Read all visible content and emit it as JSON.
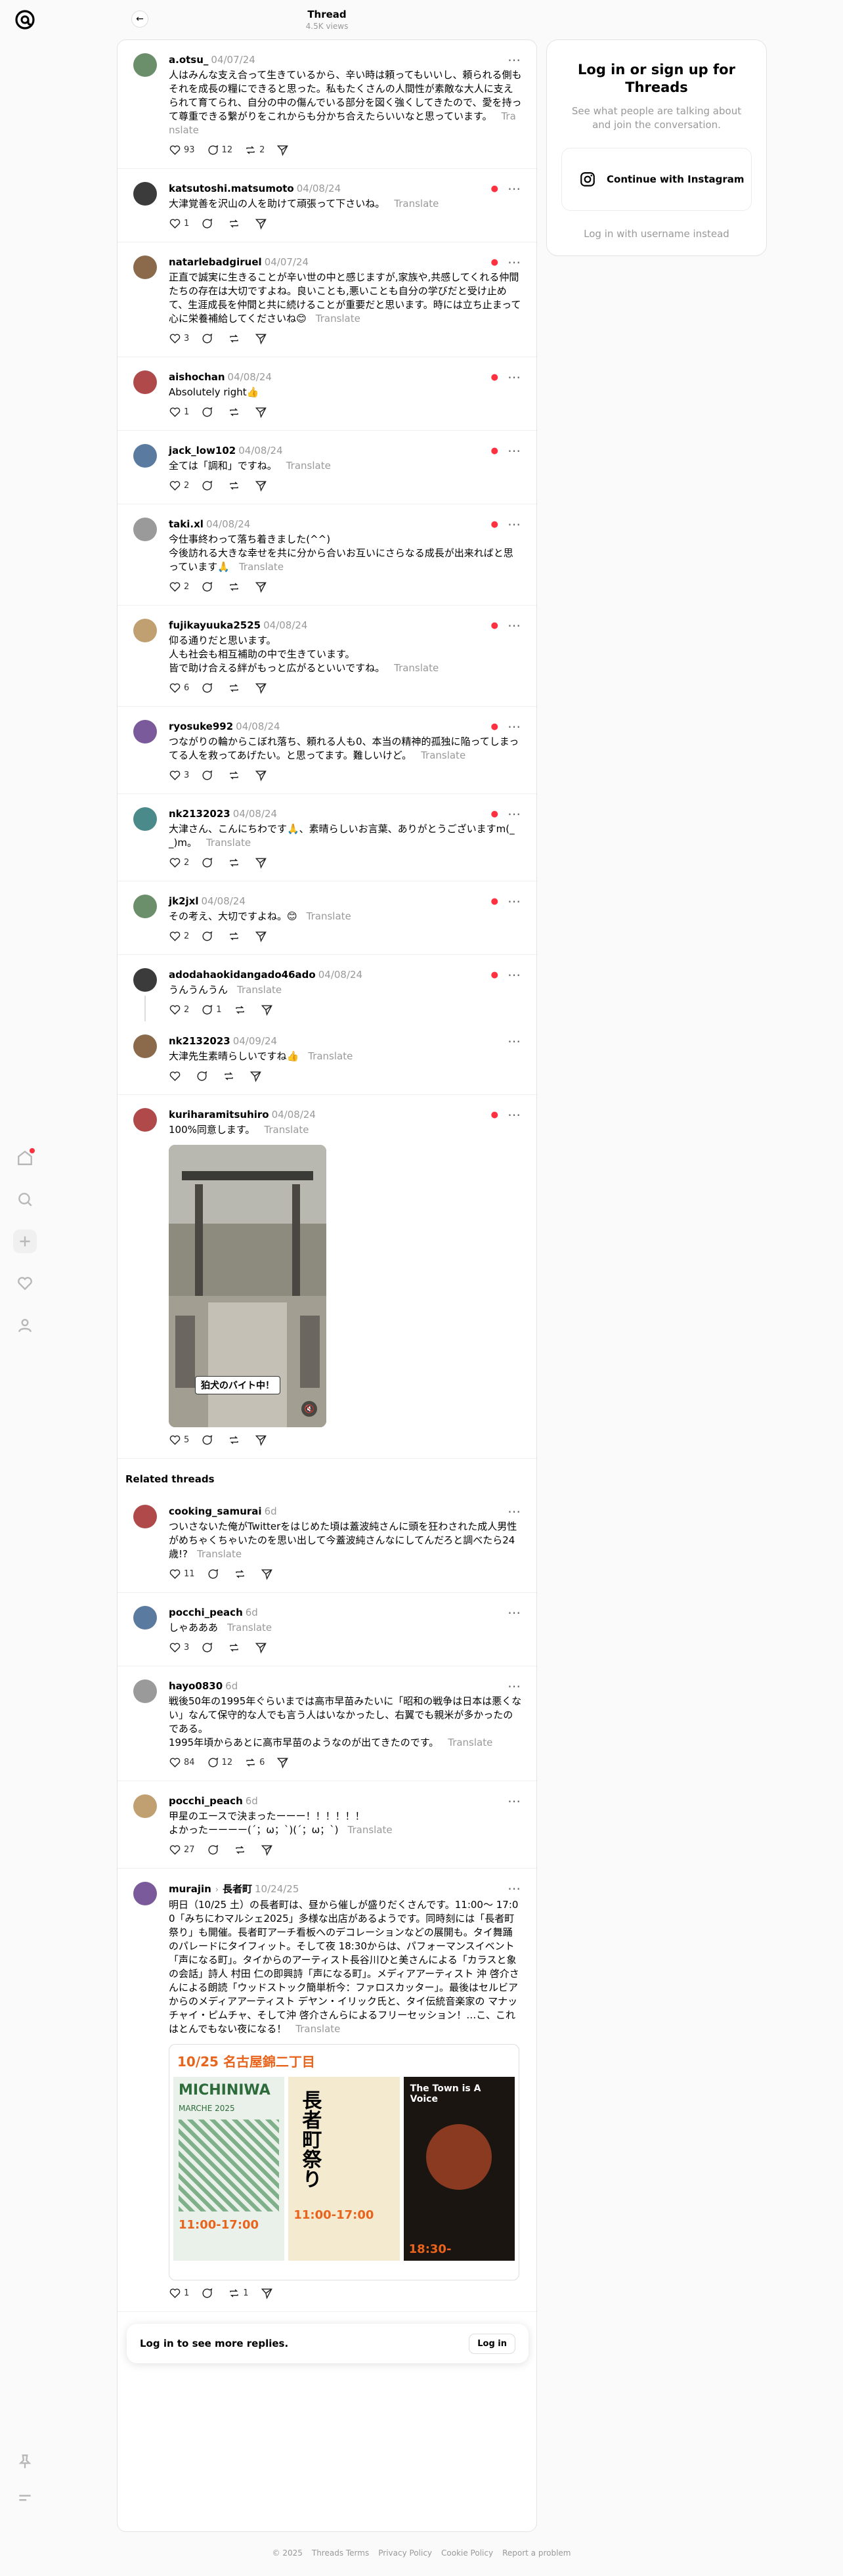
{
  "header": {
    "title": "Thread",
    "views": "4.5K views"
  },
  "nav": {
    "icons": [
      "home-icon",
      "search-icon",
      "create-icon",
      "heart-icon",
      "profile-icon"
    ],
    "bottom": [
      "pin-icon",
      "menu-icon"
    ]
  },
  "main_post": {
    "username": "a.otsu_",
    "date": "04/07/24",
    "text": "人はみんな支え合って生きているから、辛い時は頼ってもいいし、頼られる側もそれを成長の糧にできると思った。私もたくさんの人間性が素敵な大人に支えられて育てられ、自分の中の傷んでいる部分を図く強くしてきたので、愛を持って尊重できる繋がりをこれからも分かち合えたらいいなと思っています。",
    "translate": "Translate",
    "likes": "93",
    "comments": "12",
    "reposts": "2"
  },
  "replies": [
    {
      "username": "katsutoshi.matsumoto",
      "date": "04/08/24",
      "text": "大津覚善を沢山の人を助けて頑張って下さいね。",
      "translate": "Translate",
      "likes": "1",
      "comments": "",
      "reposts": "",
      "badge": true
    },
    {
      "username": "natarlebadgiruel",
      "date": "04/07/24",
      "text": "正直で誠実に生きることが辛い世の中と感じますが,家族や,共感してくれる仲間たちの存在は大切ですよね。良いことも,悪いことも自分の学びだと受け止めて、生涯成長を仲間と共に続けることが重要だと思います。時には立ち止まって心に栄養補給してくださいね😊",
      "translate": "Translate",
      "likes": "3",
      "comments": "",
      "reposts": "",
      "badge": true
    },
    {
      "username": "aishochan",
      "date": "04/08/24",
      "text": "Absolutely right👍",
      "translate": "",
      "likes": "1",
      "comments": "",
      "reposts": "",
      "badge": true
    },
    {
      "username": "jack_low102",
      "date": "04/08/24",
      "text": "全ては「調和」ですね。",
      "translate": "Translate",
      "likes": "2",
      "comments": "",
      "reposts": "",
      "badge": true
    },
    {
      "username": "taki.xl",
      "date": "04/08/24",
      "text": "今仕事終わって落ち着きました(^^)\n今後訪れる大きな幸せを共に分から合いお互いにさらなる成長が出来ればと思っています🙏",
      "translate": "Translate",
      "likes": "2",
      "comments": "",
      "reposts": "",
      "badge": true
    },
    {
      "username": "fujikayuuka2525",
      "date": "04/08/24",
      "text": "仰る通りだと思います。\n人も社会も相互補助の中で生きています。\n皆で助け合える絆がもっと広がるといいですね。",
      "translate": "Translate",
      "likes": "6",
      "comments": "",
      "reposts": "",
      "badge": true
    },
    {
      "username": "ryosuke992",
      "date": "04/08/24",
      "text": "つながりの輪からこぼれ落ち、頼れる人も0、本当の精神的孤独に陥ってしまってる人を救ってあげたい。と思ってます。難しいけど。",
      "translate": "Translate",
      "likes": "3",
      "comments": "",
      "reposts": "",
      "badge": true
    },
    {
      "username": "nk2132023",
      "date": "04/08/24",
      "text": "大津さん、こんにちわです🙏、素晴らしいお言葉、ありがとうございますm(_ _)m。",
      "translate": "Translate",
      "likes": "2",
      "comments": "",
      "reposts": "",
      "badge": true
    },
    {
      "username": "jk2jxl",
      "date": "04/08/24",
      "text": "その考え、大切ですよね。😊",
      "translate": "Translate",
      "likes": "2",
      "comments": "",
      "reposts": "",
      "badge": true
    },
    {
      "username": "adodahaokidangado46ado",
      "date": "04/08/24",
      "text": "うんうんうん",
      "translate": "Translate",
      "likes": "2",
      "comments": "1",
      "reposts": "",
      "badge": true,
      "thread": true
    },
    {
      "username": "nk2132023",
      "date": "04/09/24",
      "text": "大津先生素晴らしいですね👍",
      "translate": "Translate",
      "likes": "",
      "comments": "",
      "reposts": "",
      "badge": false,
      "nested": true
    },
    {
      "username": "kuriharamitsuhiro",
      "date": "04/08/24",
      "text": "100%同意します。",
      "translate": "Translate",
      "likes": "5",
      "comments": "",
      "reposts": "",
      "badge": true,
      "media": true,
      "caption": "狛犬のバイト中！"
    }
  ],
  "related_title": "Related threads",
  "related": [
    {
      "username": "cooking_samurai",
      "date": "6d",
      "text": "ついさないた俺がTwitterをはじめた頃は蓋波純さんに頭を狂わされた成人男性がめちゃくちゃいたのを思い出して今蓋波純さんなにしてんだろと調べたら24歳!?",
      "translate": "Translate",
      "likes": "11",
      "comments": "",
      "reposts": ""
    },
    {
      "username": "pocchi_peach",
      "date": "6d",
      "text": "しゃあああ",
      "translate": "Translate",
      "likes": "3",
      "comments": "",
      "reposts": ""
    },
    {
      "username": "hayo0830",
      "date": "6d",
      "text": "戦後50年の1995年ぐらいまでは高市早苗みたいに「昭和の戦争は日本は悪くない」なんて保守的な人でも言う人はいなかったし、右翼でも親米が多かったのである。\n1995年頃からあとに高市早苗のようなのが出てきたのです。",
      "translate": "Translate",
      "likes": "84",
      "comments": "12",
      "reposts": "6"
    },
    {
      "username": "pocchi_peach",
      "date": "6d",
      "text": "甲星のエースで決まったーーー！！！！！！\nよかったーーーー(´；ω；`)(´；ω；`)",
      "translate": "Translate",
      "likes": "27",
      "comments": "",
      "reposts": ""
    },
    {
      "username": "murajin",
      "topic": "長者町",
      "date": "10/24/25",
      "text": "明日（10/25 土）の長者町は、昼から催しが盛りだくさんです。11:00〜 17:00「みちにわマルシェ2025」多様な出店があるようです。同時刻には「長者町祭り」も開催。長者町アーチ看板へのデコレーションなどの展開も。タイ舞踊のパレードにタイフィット。そして夜 18:30からは、パフォーマンスイベント「声になる町」。タイからのアーティスト長谷川ひと美さんによる「カラスと象の会話」詩人 村田 仁の即興詩「声になる町」。メディアアーティスト 沖 啓介さんによる朗読「ウッドストック簡単析今：ファロスカッター」。最後はセルビアからのメディアアーティスト デヤン・イリック氏と、タイ伝統音楽家の マナッチャイ・ピムチャ、そして沖 啓介さんらによるフリーセッション！…こ、これはとんでもない夜になる！",
      "translate": "Translate",
      "likes": "1",
      "comments": "",
      "reposts": "1",
      "event": {
        "brand": "10/25",
        "district": "名古屋錦二丁目",
        "p1": "MICHINIWA",
        "p1sub": "MARCHE 2025",
        "p2": "長者町祭り",
        "p3": "The Town is A Voice",
        "time1": "11:00-17:00",
        "time2": "11:00-17:00",
        "time3": "18:30-"
      }
    }
  ],
  "login_bar": {
    "text": "Log in to see more replies.",
    "button": "Log in"
  },
  "side": {
    "title": "Log in or sign up for Threads",
    "subtitle": "See what people are talking about and join the conversation.",
    "ig": "Continue with Instagram",
    "alt": "Log in with username instead"
  },
  "footer": [
    "© 2025",
    "Threads Terms",
    "Privacy Policy",
    "Cookie Policy",
    "Report a problem"
  ],
  "colors": {
    "accent": "#ff3040",
    "muted": "#999999",
    "border": "#e3e3e3"
  }
}
